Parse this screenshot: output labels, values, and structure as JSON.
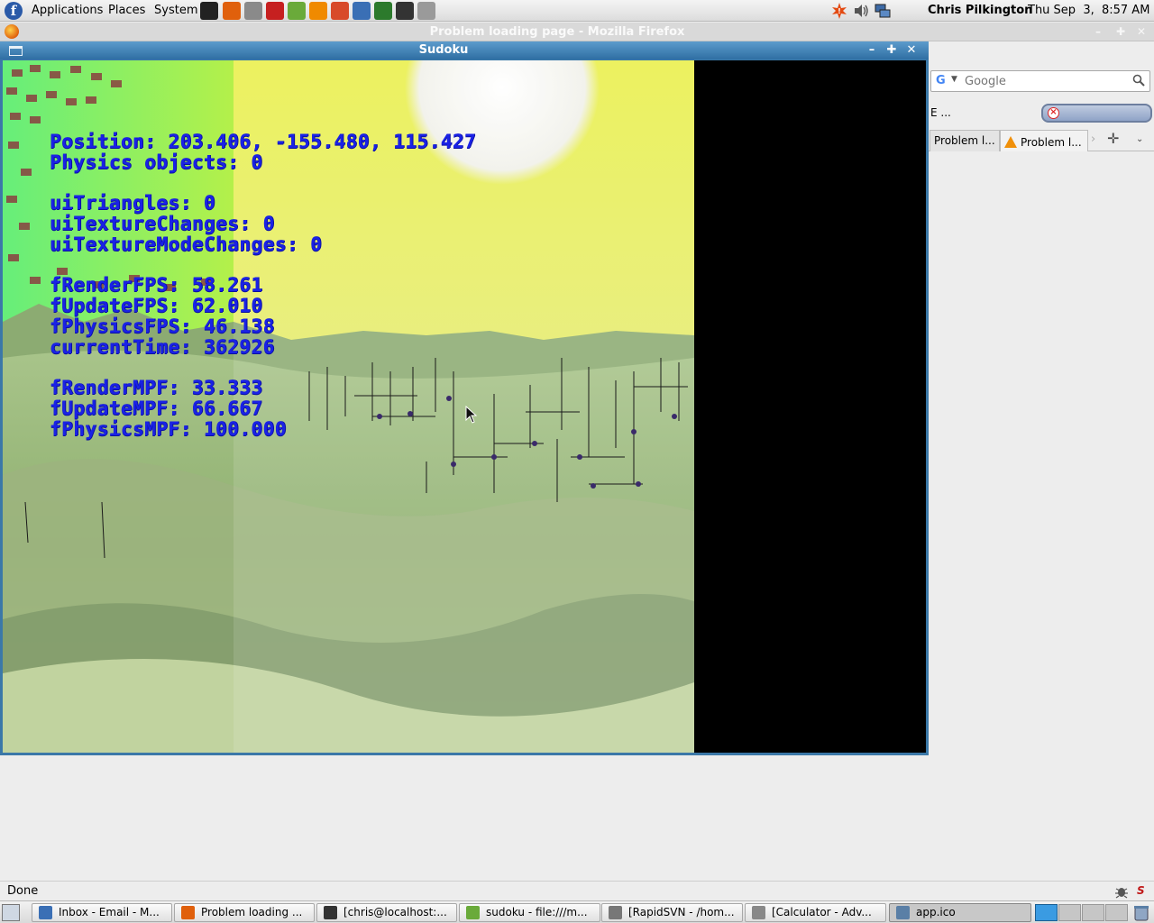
{
  "top_panel": {
    "menus": [
      "Applications",
      "Places",
      "System"
    ],
    "launchers": [
      {
        "name": "inkscape-launcher-icon",
        "color": "#222222"
      },
      {
        "name": "firefox-launcher-icon",
        "color": "#e0600c"
      },
      {
        "name": "printer-launcher-icon",
        "color": "#8a8a8a"
      },
      {
        "name": "filezilla-launcher-icon",
        "color": "#c62020"
      },
      {
        "name": "bug-launcher-icon",
        "color": "#6aaa3a"
      },
      {
        "name": "vlc-launcher-icon",
        "color": "#f08a00"
      },
      {
        "name": "mib-launcher-icon",
        "color": "#d84a2a"
      },
      {
        "name": "thunderbird-launcher-icon",
        "color": "#3a6fb5"
      },
      {
        "name": "system-monitor-launcher-icon",
        "color": "#2c7a2c"
      },
      {
        "name": "terminal-launcher-icon",
        "color": "#333333"
      },
      {
        "name": "disk-launcher-icon",
        "color": "#9a9a9a"
      }
    ],
    "user": "Chris Pilkington",
    "clock": "Thu Sep  3,  8:57 AM"
  },
  "firefox": {
    "title": "Problem loading page - Mozilla Firefox",
    "search_placeholder": "Google",
    "bookmark_fragment": "E ...",
    "tabs": [
      "Problem l...",
      "Problem l..."
    ]
  },
  "sudoku_window": {
    "title": "Sudoku",
    "stats": [
      "Position: 203.406, -155.480, 115.427",
      "Physics objects: 0",
      "",
      "uiTriangles: 0",
      "uiTextureChanges: 0",
      "uiTextureModeChanges: 0",
      "",
      "fRenderFPS: 58.261",
      "fUpdateFPS: 62.010",
      "fPhysicsFPS: 46.138",
      "currentTime: 362926",
      "",
      "fRenderMPF: 33.333",
      "fUpdateMPF: 66.667",
      "fPhysicsMPF: 100.000"
    ]
  },
  "status_bar": {
    "text": "Done"
  },
  "taskbar": {
    "tasks": [
      {
        "label": "Inbox - Email - M...",
        "icon": "thunderbird-icon",
        "color": "#3a6fb5"
      },
      {
        "label": "Problem loading ...",
        "icon": "firefox-icon",
        "color": "#e0600c"
      },
      {
        "label": "[chris@localhost:...",
        "icon": "terminal-icon",
        "color": "#333333"
      },
      {
        "label": "sudoku - file:///m...",
        "icon": "bug-icon",
        "color": "#6aaa3a"
      },
      {
        "label": "[RapidSVN - /hom...",
        "icon": "rapidsvn-icon",
        "color": "#777777"
      },
      {
        "label": "[Calculator - Adv...",
        "icon": "calculator-icon",
        "color": "#888888"
      },
      {
        "label": "app.ico",
        "icon": "window-icon",
        "color": "#5a7fa6"
      }
    ]
  }
}
